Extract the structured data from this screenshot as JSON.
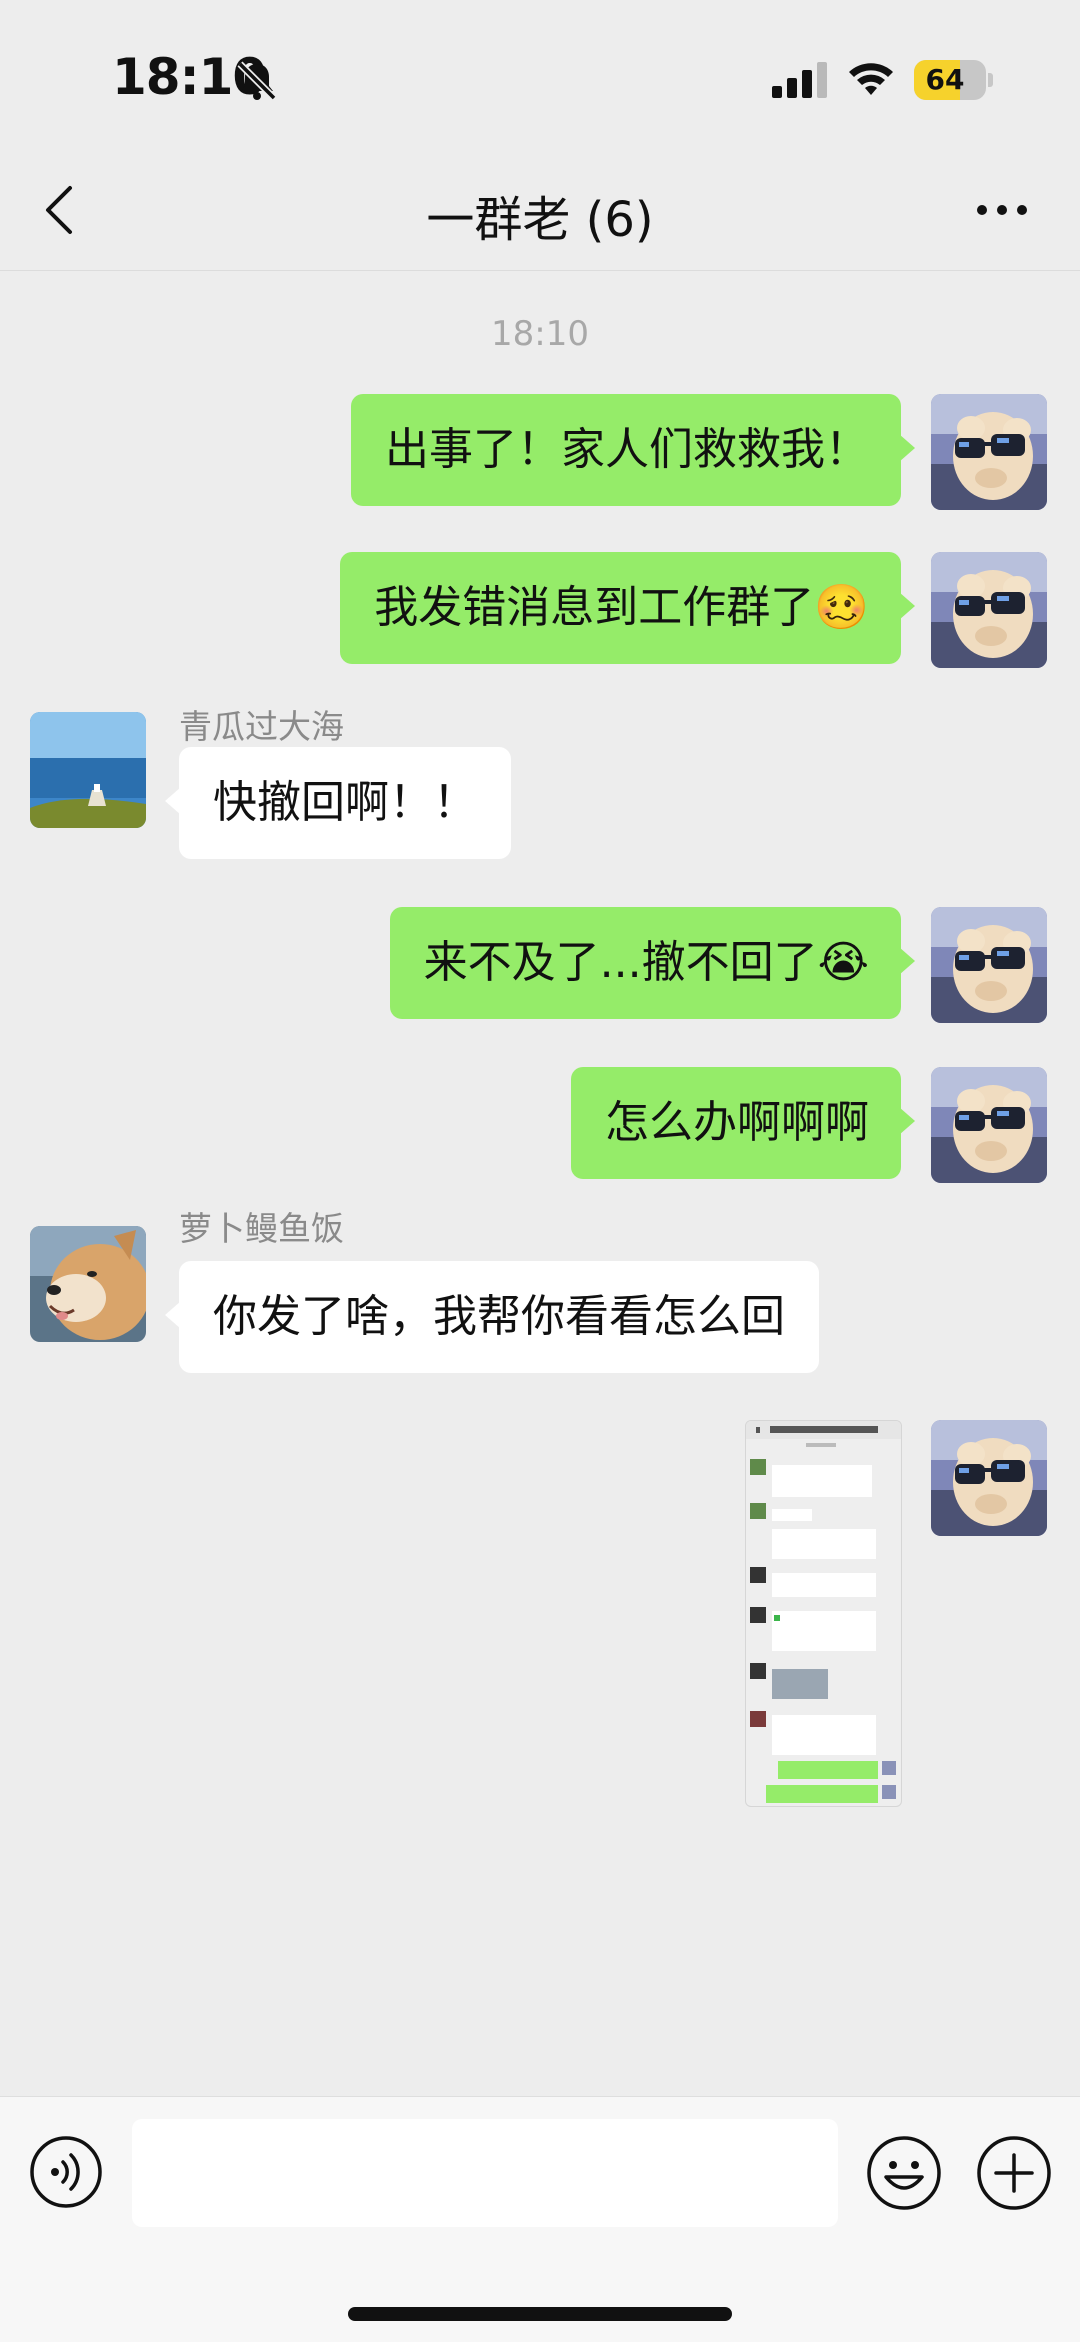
{
  "status_bar": {
    "time": "18:10",
    "battery": "64",
    "battery_level": 0.64
  },
  "nav": {
    "title": "一群老 (6)"
  },
  "chat": {
    "timestamp": "18:10",
    "messages": [
      {
        "from": "me",
        "text": "出事了！家人们救救我！"
      },
      {
        "from": "me",
        "text": "我发错消息到工作群了",
        "emoji": "🥴"
      },
      {
        "from": "other",
        "sender": "青瓜过大海",
        "text": "快撤回啊！！"
      },
      {
        "from": "me",
        "text": "来不及了...撤不回了",
        "emoji": "😭"
      },
      {
        "from": "me",
        "text": "怎么办啊啊啊"
      },
      {
        "from": "other",
        "sender": "萝卜鳗鱼饭",
        "text": "你发了啥，我帮你看看怎么回"
      },
      {
        "from": "me",
        "type": "image",
        "image_title": "深圳 · 量河医子居工作总群 (283)"
      }
    ]
  },
  "colors": {
    "outgoing_bubble": "#95ec69",
    "incoming_bubble": "#ffffff",
    "background": "#ededed"
  },
  "icons": [
    "bell-slash-icon",
    "signal-icon",
    "wifi-icon",
    "back-icon",
    "more-icon",
    "voice-icon",
    "emoji-icon",
    "plus-icon"
  ]
}
